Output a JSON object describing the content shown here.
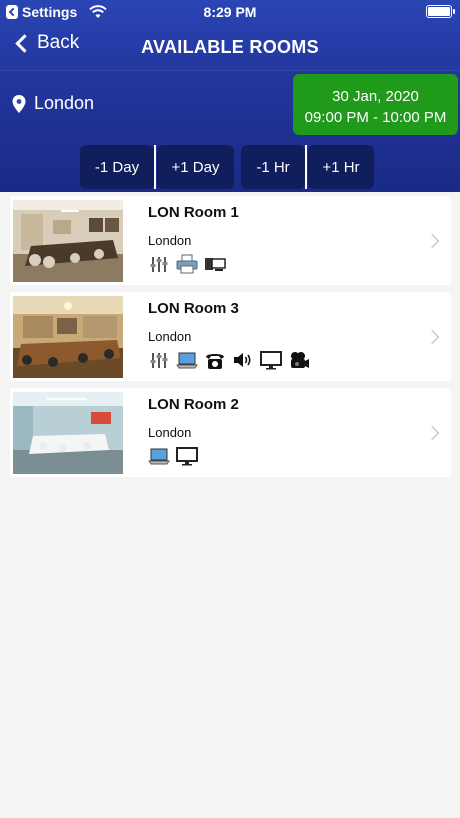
{
  "status_bar": {
    "back_app": "Settings",
    "time": "8:29 PM"
  },
  "nav": {
    "back_label": "Back",
    "title": "AVAILABLE ROOMS"
  },
  "location": "London",
  "datetime": {
    "date": "30 Jan, 2020",
    "range": "09:00 PM - 10:00 PM"
  },
  "adjust_buttons": [
    "-1 Day",
    "+1 Day",
    "-1 Hr",
    "+1 Hr"
  ],
  "rooms": [
    {
      "name": "LON Room 1",
      "city": "London",
      "amenities": [
        "audio-mixer-icon",
        "printer-icon",
        "computer-icon"
      ]
    },
    {
      "name": "LON Room 3",
      "city": "London",
      "amenities": [
        "audio-mixer-icon",
        "laptop-icon",
        "phone-icon",
        "speaker-icon",
        "monitor-icon",
        "camera-icon"
      ]
    },
    {
      "name": "LON Room 2",
      "city": "London",
      "amenities": [
        "laptop-icon",
        "monitor-icon"
      ]
    }
  ],
  "colors": {
    "header_top": "#2a45b4",
    "header_bottom": "#1a2a86",
    "date_box": "#1f9a1a",
    "adjust_button": "#101f5c",
    "background": "#f4f4f4"
  }
}
